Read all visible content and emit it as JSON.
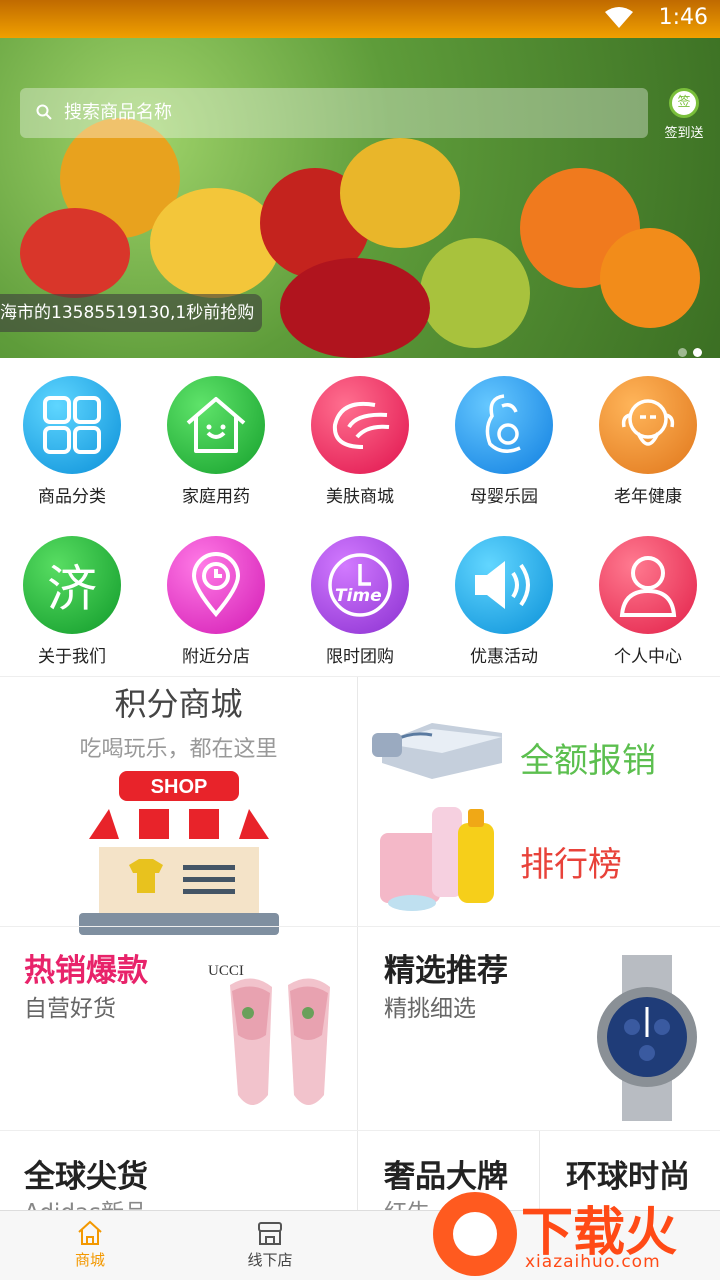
{
  "status_bar": {
    "time": "1:46"
  },
  "banner": {
    "search_placeholder": "搜索商品名称",
    "checkin_label": "签到送",
    "checkin_badge": "签",
    "ticker_text": "海市的13585519130,1秒前抢购",
    "page_dots": 2,
    "active_dot": 1
  },
  "grid_row1": [
    {
      "label": "商品分类",
      "icon": "category-grid-icon",
      "color": "#1aa9e8"
    },
    {
      "label": "家庭用药",
      "icon": "home-medicine-icon",
      "color": "#22b33a"
    },
    {
      "label": "美肤商城",
      "icon": "beauty-icon",
      "color": "#ef2e5f"
    },
    {
      "label": "母婴乐园",
      "icon": "mother-baby-icon",
      "color": "#1a8fe8"
    },
    {
      "label": "老年健康",
      "icon": "elder-icon",
      "color": "#f0891e"
    }
  ],
  "grid_row2": [
    {
      "label": "关于我们",
      "icon": "about-ji-icon",
      "color": "#1fa83b",
      "glyph": "济"
    },
    {
      "label": "附近分店",
      "icon": "location-pin-icon",
      "color": "#e636c7"
    },
    {
      "label": "限时团购",
      "icon": "time-clock-icon",
      "color": "#a94de0",
      "glyph": "Time"
    },
    {
      "label": "优惠活动",
      "icon": "speaker-icon",
      "color": "#17a5e6"
    },
    {
      "label": "个人中心",
      "icon": "user-icon",
      "color": "#f0325a"
    }
  ],
  "promo": {
    "mall_title": "积分商城",
    "mall_subtitle": "吃喝玩乐，都在这里",
    "shop_sign": "SHOP",
    "reimburse": "全额报销",
    "ranking": "排行榜"
  },
  "section2": {
    "hot_title": "热销爆款",
    "hot_subtitle": "自营好货",
    "hot_color": "#e8236a",
    "brand_text": "UCCI",
    "pick_title": "精选推荐",
    "pick_subtitle": "精挑细选"
  },
  "section3": {
    "global_title": "全球尖货",
    "global_subtitle": "Adidas新品",
    "luxury_title": "奢品大牌",
    "luxury_subtitle": "红牛",
    "fashion_title": "环球时尚",
    "fashion_subtitle": ""
  },
  "tabbar": {
    "tabs": [
      {
        "label": "商城",
        "active": true
      },
      {
        "label": "线下店",
        "active": false
      }
    ],
    "active_color": "#f39800"
  },
  "watermark": {
    "title": "下载火",
    "site": "xiazaihuo.com"
  }
}
